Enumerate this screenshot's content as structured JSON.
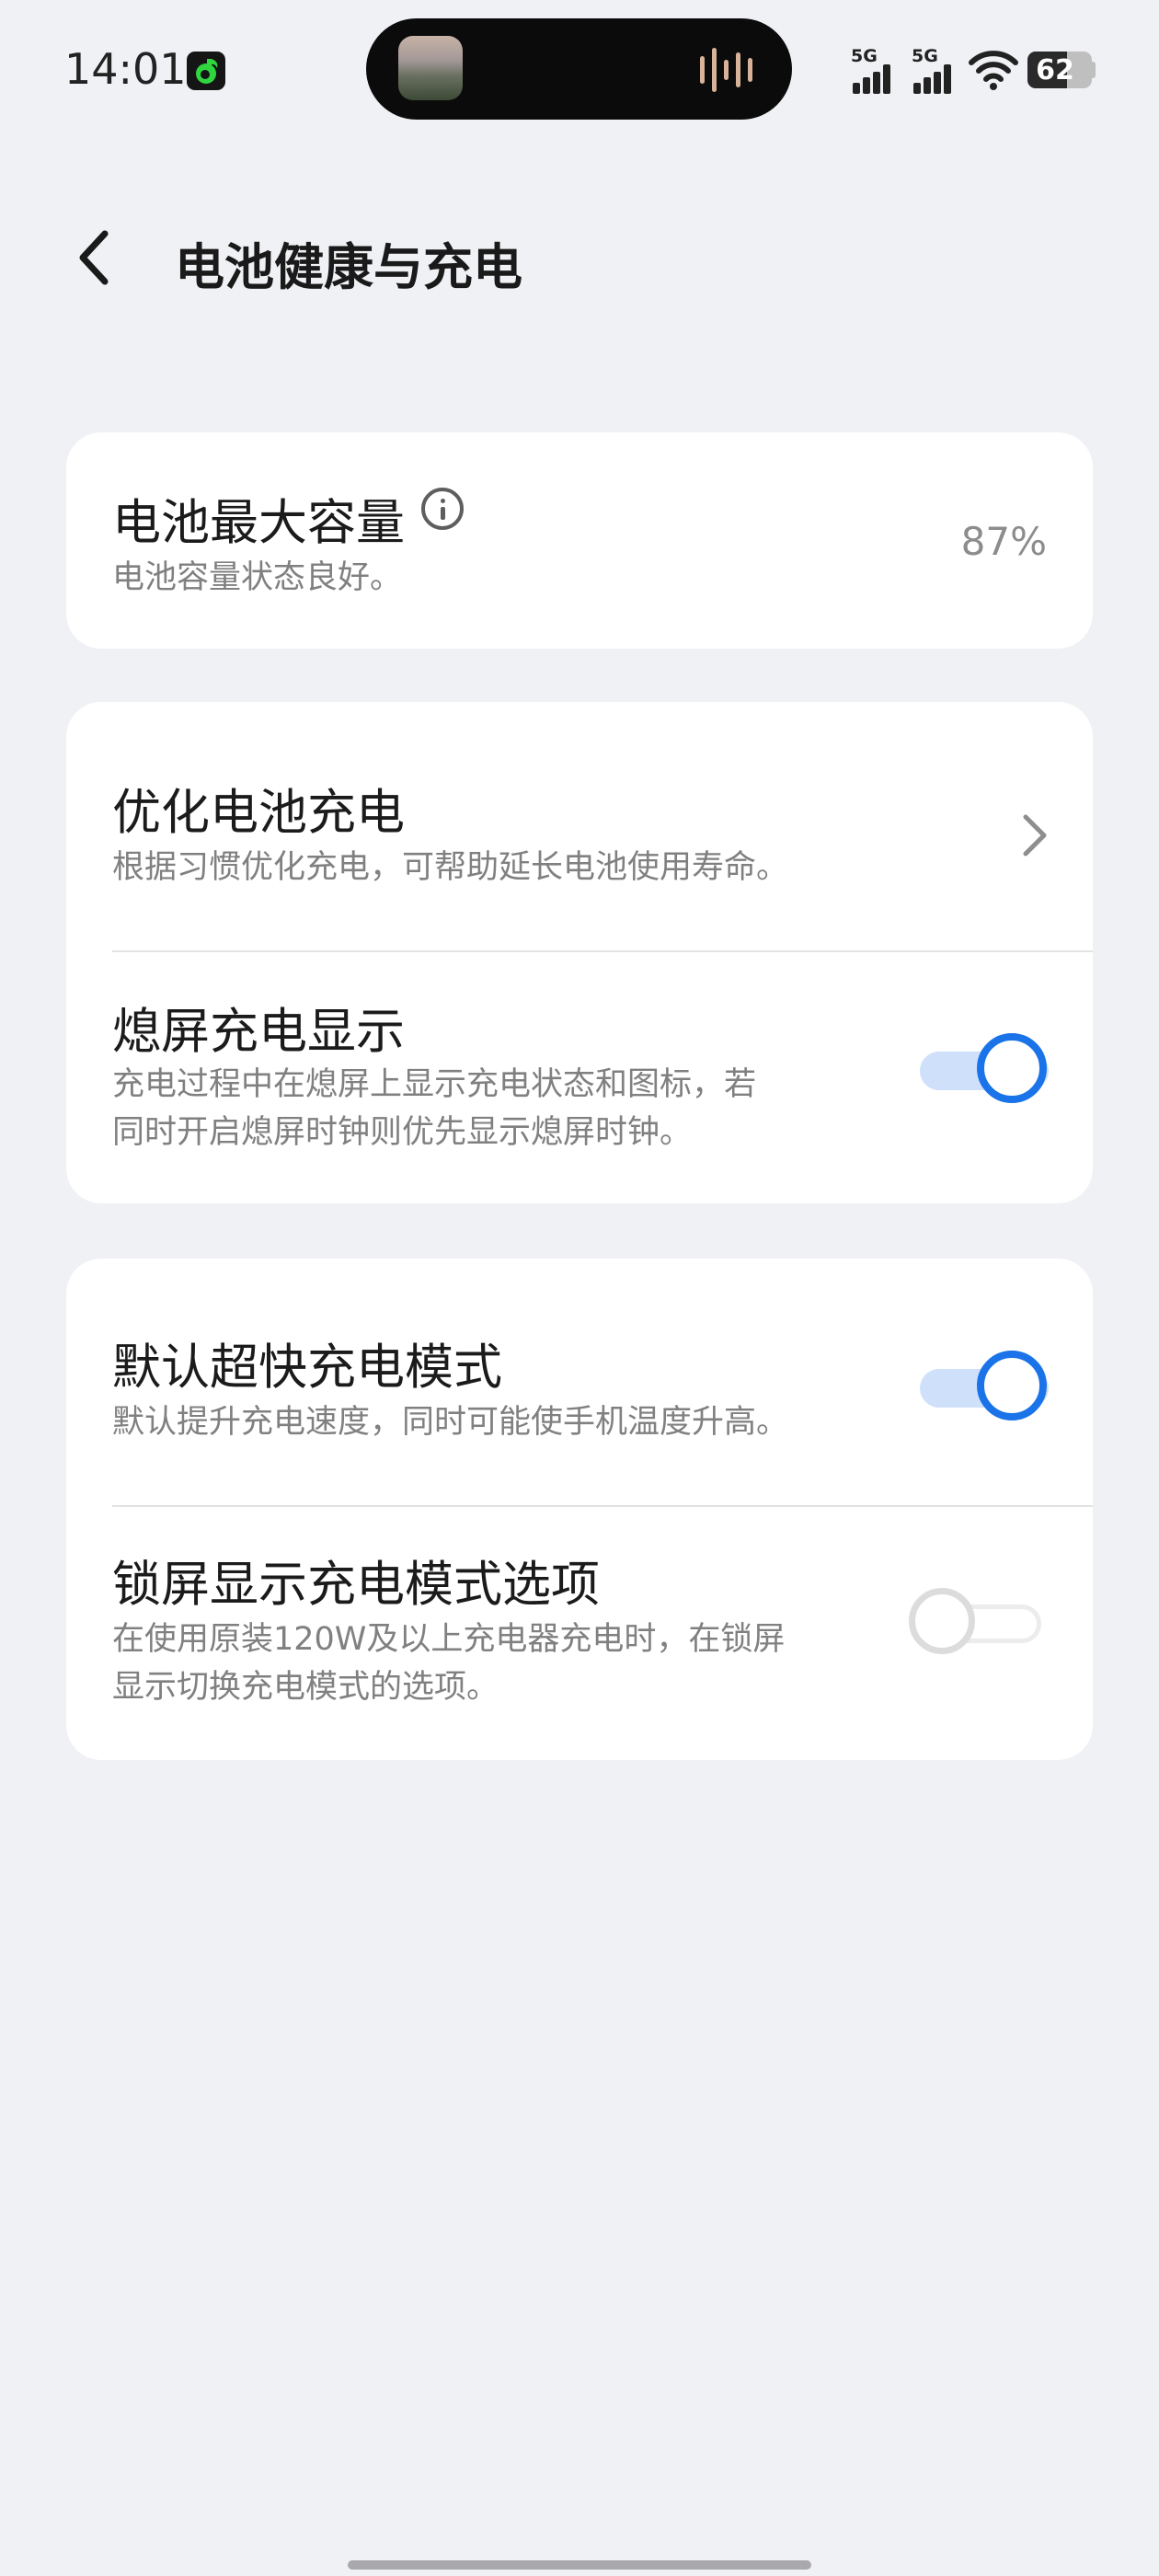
{
  "status_bar": {
    "time": "14:01",
    "app_badge_icon": "music-note-icon",
    "signal_1_label": "5G",
    "signal_2_label": "5G",
    "wifi_icon": "wifi-icon",
    "battery_level": "62",
    "battery_fraction": 0.62
  },
  "header": {
    "title": "电池健康与充电",
    "back_icon": "back-arrow-icon"
  },
  "battery_capacity": {
    "title": "电池最大容量",
    "info_icon": "info-icon",
    "subtitle": "电池容量状态良好。",
    "value": "87%"
  },
  "optimize_charging": {
    "title": "优化电池充电",
    "subtitle": "根据习惯优化充电，可帮助延长电池使用寿命。",
    "chevron_icon": "chevron-right-icon"
  },
  "aod_charging": {
    "title": "熄屏充电显示",
    "subtitle_line1": "充电过程中在熄屏上显示充电状态和图标，若",
    "subtitle_line2": "同时开启熄屏时钟则优先显示熄屏时钟。",
    "enabled": true
  },
  "super_fast_charging": {
    "title": "默认超快充电模式",
    "subtitle": "默认提升充电速度，同时可能使手机温度升高。",
    "enabled": true
  },
  "lockscreen_charge_mode": {
    "title": "锁屏显示充电模式选项",
    "subtitle_line1": "在使用原装120W及以上充电器充电时，在锁屏",
    "subtitle_line2": "显示切换充电模式的选项。",
    "enabled": false
  },
  "colors": {
    "accent": "#1a73e8",
    "background": "#f0f1f4",
    "card": "#ffffff"
  }
}
